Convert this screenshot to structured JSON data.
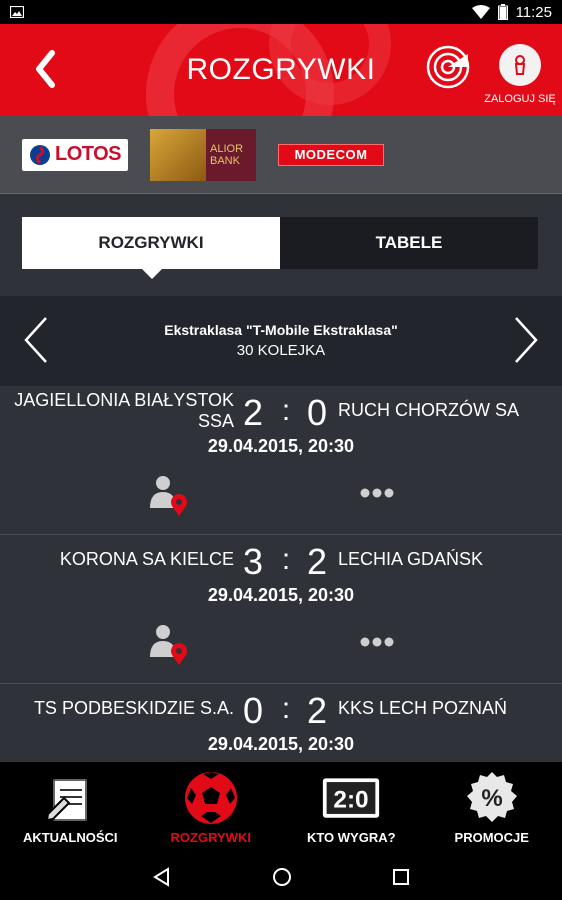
{
  "status_bar": {
    "time": "11:25"
  },
  "header": {
    "title": "ROZGRYWKI",
    "login_label": "ZALOGUJ SIĘ"
  },
  "sponsors": {
    "lotos": "LOTOS",
    "alior_line1": "ALIOR",
    "alior_line2": "BANK",
    "modecom": "MODECOM"
  },
  "tabs": [
    {
      "label": "ROZGRYWKI",
      "active": true
    },
    {
      "label": "TABELE",
      "active": false
    }
  ],
  "league": {
    "name": "Ekstraklasa \"T-Mobile Ekstraklasa\"",
    "round": "30 KOLEJKA"
  },
  "matches": [
    {
      "home": "JAGIELLONIA BIAŁYSTOK SSA",
      "home_goals": "2",
      "separator": ":",
      "away_goals": "0",
      "away": "RUCH CHORZÓW SA",
      "datetime": "29.04.2015, 20:30"
    },
    {
      "home": "KORONA SA KIELCE",
      "home_goals": "3",
      "separator": ":",
      "away_goals": "2",
      "away": "LECHIA GDAŃSK",
      "datetime": "29.04.2015, 20:30"
    },
    {
      "home": "TS PODBESKIDZIE S.A.",
      "home_goals": "0",
      "separator": ":",
      "away_goals": "2",
      "away": "KKS LECH POZNAŃ",
      "datetime": "29.04.2015, 20:30"
    }
  ],
  "bottom_nav": [
    {
      "label": "AKTUALNOŚCI",
      "icon": "news-icon",
      "active": false
    },
    {
      "label": "ROZGRYWKI",
      "icon": "football-icon",
      "active": true
    },
    {
      "label": "KTO WYGRA?",
      "icon": "scoreboard-icon",
      "active": false
    },
    {
      "label": "PROMOCJE",
      "icon": "percent-badge-icon",
      "active": false
    }
  ],
  "scoreboard_icon_text": "2:0",
  "percent_icon_text": "%",
  "colors": {
    "primary_red": "#e30a17",
    "background": "#2f3239",
    "nav_dark": "#23252c"
  }
}
